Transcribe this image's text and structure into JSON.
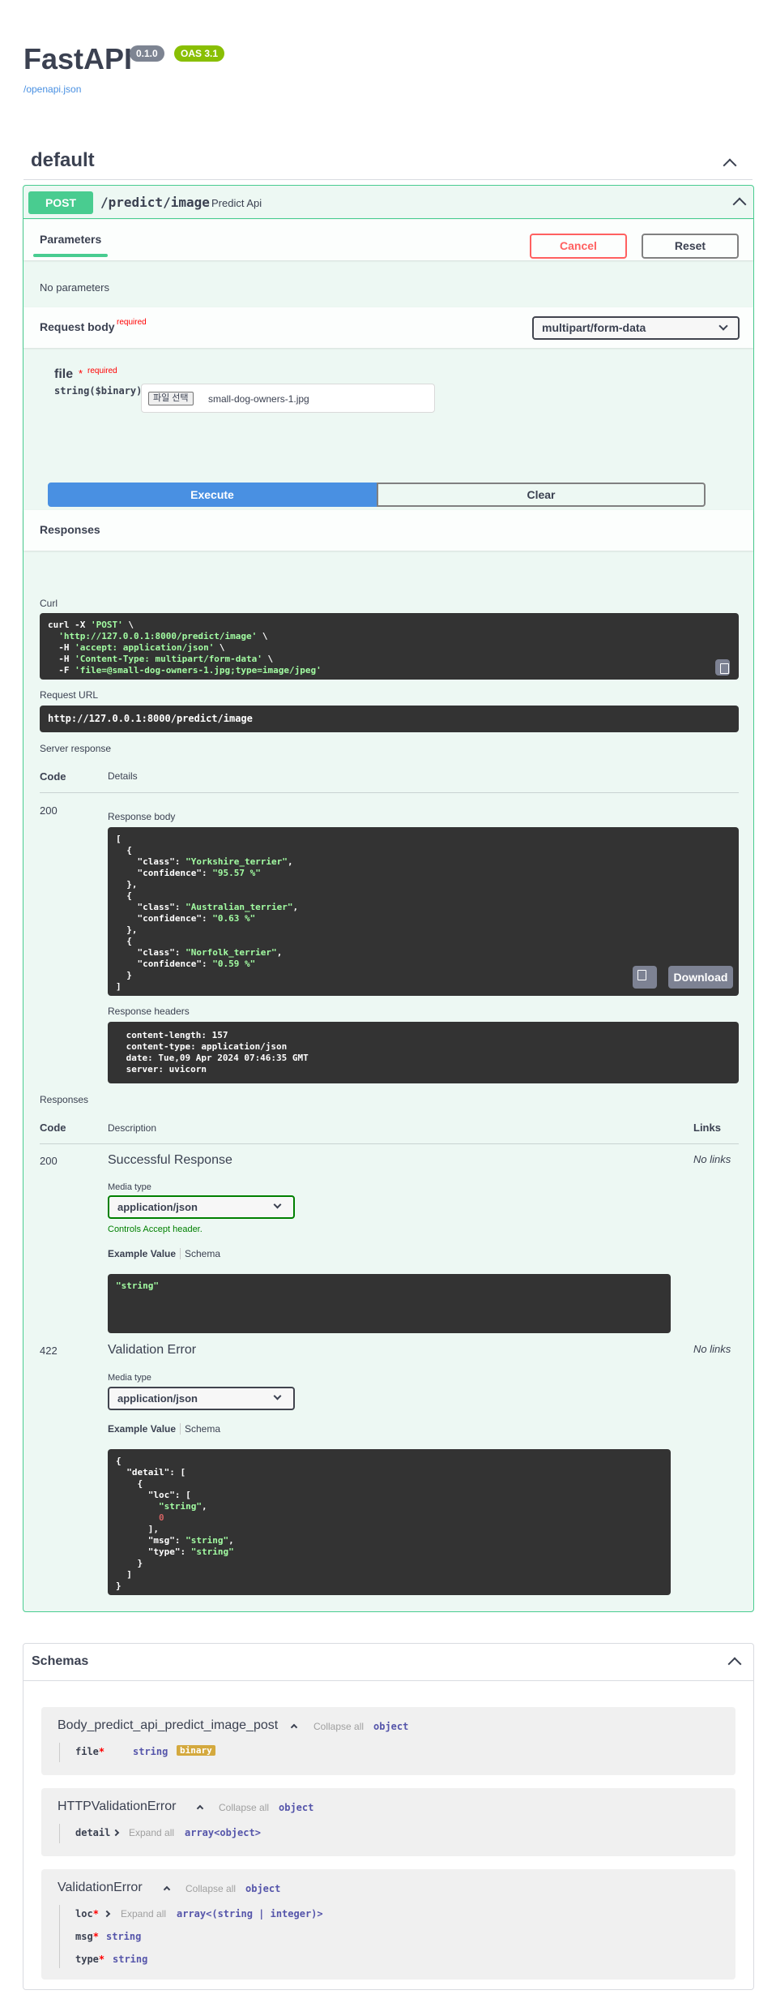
{
  "header": {
    "title": "FastAPI",
    "version": "0.1.0",
    "oas": "OAS 3.1",
    "openapi_link": "/openapi.json"
  },
  "tag": {
    "title": "default"
  },
  "operation": {
    "method": "POST",
    "path": "/predict/image",
    "summary": "Predict Api",
    "parameters_tab": "Parameters",
    "cancel_label": "Cancel",
    "reset_label": "Reset",
    "no_parameters": "No parameters",
    "request_body_label": "Request body",
    "required": "required",
    "content_type": "multipart/form-data",
    "file_label": "file",
    "file_required": "required",
    "file_type": "string($binary)",
    "file_button": "파일 선택",
    "file_name": "small-dog-owners-1.jpg",
    "execute_label": "Execute",
    "clear_label": "Clear",
    "responses_title": "Responses"
  },
  "live": {
    "curl_label": "Curl",
    "curl_lines": [
      {
        "plain": "curl -X ",
        "str": "'POST'",
        "tail": " \\"
      },
      {
        "plain": "  ",
        "str": "'http://127.0.0.1:8000/predict/image'",
        "tail": " \\"
      },
      {
        "plain": "  -H ",
        "str": "'accept: application/json'",
        "tail": " \\"
      },
      {
        "plain": "  -H ",
        "str": "'Content-Type: multipart/form-data'",
        "tail": " \\"
      },
      {
        "plain": "  -F ",
        "str": "'file=@small-dog-owners-1.jpg;type=image/jpeg'",
        "tail": ""
      }
    ],
    "request_url_label": "Request URL",
    "request_url": "http://127.0.0.1:8000/predict/image",
    "server_response_label": "Server response",
    "code_header": "Code",
    "details_header": "Details",
    "status_code": "200",
    "response_body_label": "Response body",
    "response_body": [
      {
        "class": "Yorkshire_terrier",
        "confidence": "95.57 %"
      },
      {
        "class": "Australian_terrier",
        "confidence": "0.63 %"
      },
      {
        "class": "Norfolk_terrier",
        "confidence": "0.59 %"
      }
    ],
    "download_label": "Download",
    "response_headers_label": "Response headers",
    "response_headers": [
      "content-length: 157",
      "content-type: application/json",
      "date: Tue,09 Apr 2024 07:46:35 GMT",
      "server: uvicorn"
    ]
  },
  "responses": {
    "title": "Responses",
    "code_header": "Code",
    "description_header": "Description",
    "links_header": "Links",
    "items": [
      {
        "code": "200",
        "description": "Successful Response",
        "links": "No links",
        "media_type_label": "Media type",
        "media_type": "application/json",
        "controls_note": "Controls Accept header.",
        "example_tab": "Example Value",
        "schema_tab": "Schema",
        "example": "\"string\""
      },
      {
        "code": "422",
        "description": "Validation Error",
        "links": "No links",
        "media_type_label": "Media type",
        "media_type": "application/json",
        "example_tab": "Example Value",
        "schema_tab": "Schema"
      }
    ]
  },
  "schemas": {
    "title": "Schemas",
    "items": [
      {
        "name": "Body_predict_api_predict_image_post",
        "toggle": "Collapse all",
        "type": "object",
        "props": [
          {
            "name": "file",
            "type": "string",
            "format": "binary"
          }
        ]
      },
      {
        "name": "HTTPValidationError",
        "toggle": "Collapse all",
        "type": "object",
        "props": [
          {
            "name": "detail",
            "toggle": "Expand all",
            "type": "array<object>"
          }
        ]
      },
      {
        "name": "ValidationError",
        "toggle": "Collapse all",
        "type": "object",
        "props": [
          {
            "name": "loc",
            "toggle": "Expand all",
            "type": "array<(string | integer)>"
          },
          {
            "name": "msg",
            "type": "string"
          },
          {
            "name": "type",
            "type": "string"
          }
        ]
      }
    ]
  }
}
